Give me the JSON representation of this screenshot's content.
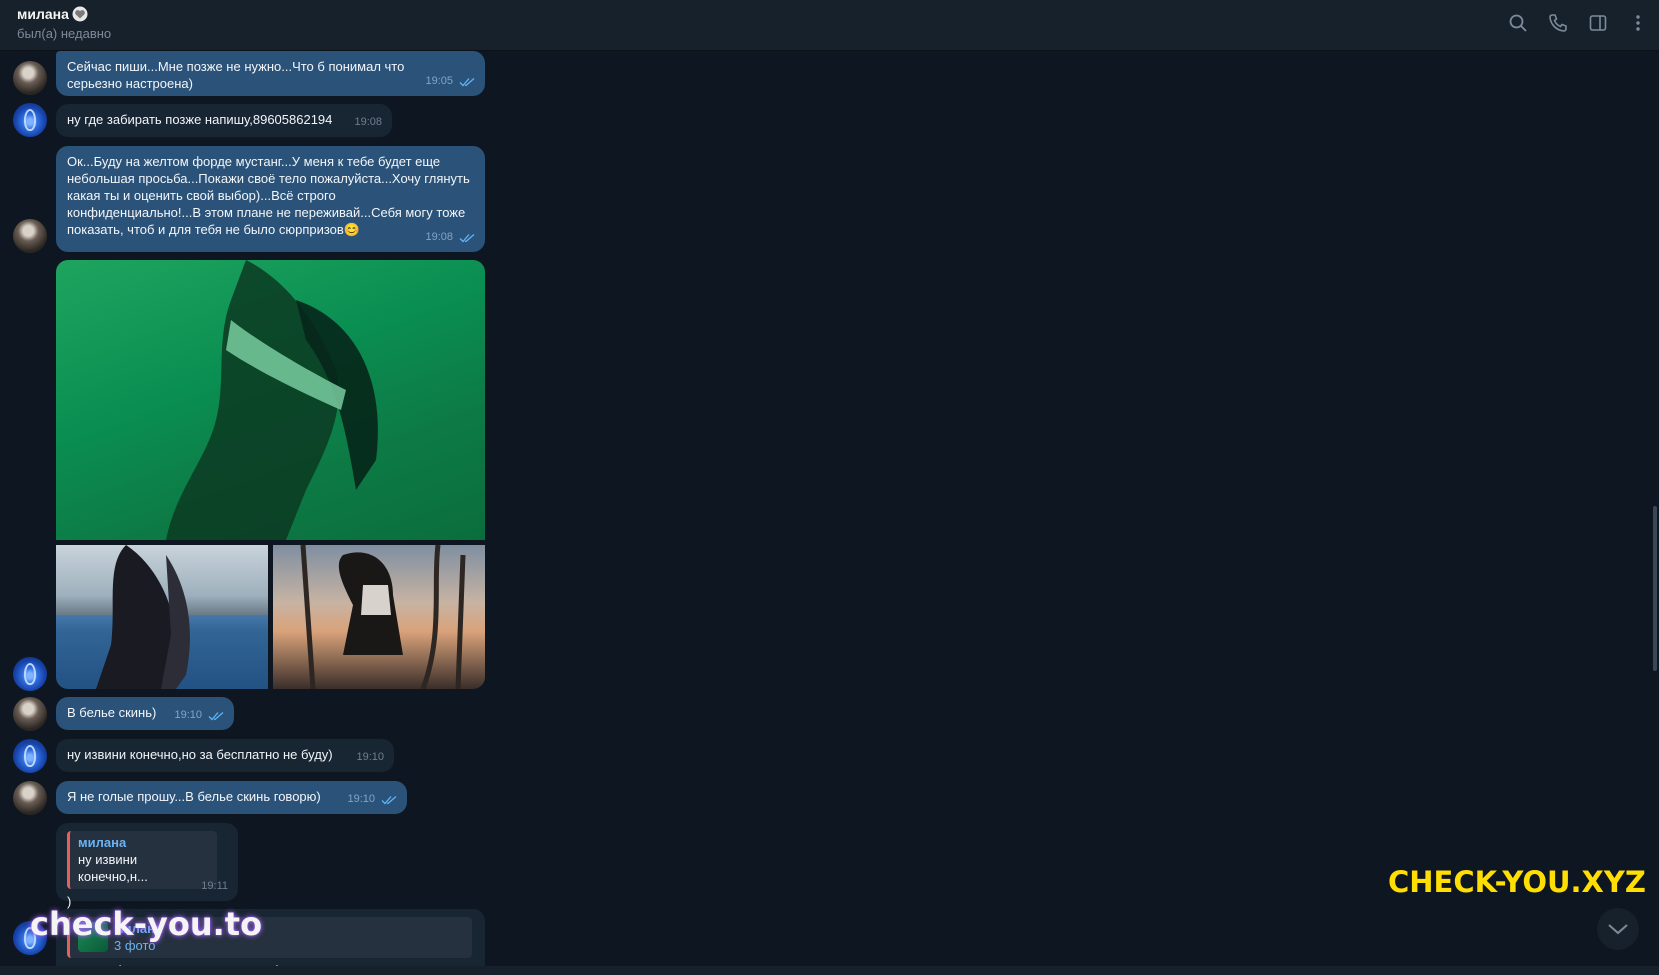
{
  "header": {
    "contact_name": "милана",
    "status": "был(а) недавно"
  },
  "icons": {
    "search": "search-icon",
    "call": "phone-icon",
    "sidebar": "sidebar-toggle-icon",
    "menu": "more-vertical-icon",
    "heart": "heart-icon",
    "ticks": "double-check-icon",
    "scroll_down": "chevron-down-icon"
  },
  "messages": [
    {
      "direction": "out",
      "text": "Сейчас пиши...Мне позже не нужно...Что б понимал что серьезно настроена)",
      "time": "19:05",
      "read": true
    },
    {
      "direction": "in",
      "text": "ну где забирать позже напишу,89605862194",
      "time": "19:08"
    },
    {
      "direction": "out",
      "text": "Ок...Буду на желтом форде мустанг...У меня к тебе будет еще небольшая просьба...Покажи своё тело пожалуйста...Хочу глянуть какая ты и оценить свой выбор)...Всё строго конфиденциально!...В этом плане не переживай...Себя могу тоже показать, чтоб и для тебя не было сюрпризов😊",
      "time": "19:08",
      "read": true
    },
    {
      "direction": "in",
      "type": "album",
      "photos": 3
    },
    {
      "direction": "out",
      "text": "В белье скинь)",
      "time": "19:10",
      "read": true
    },
    {
      "direction": "in",
      "text": "ну извини конечно,но за бесплатно не буду)",
      "time": "19:10"
    },
    {
      "direction": "out",
      "text": "Я не голые прошу...В белье скинь говорю)",
      "time": "19:10",
      "read": true
    },
    {
      "direction": "in",
      "reply_to": {
        "name": "милана",
        "text": "ну извини конечно,н..."
      },
      "text": ")",
      "time": "19:11"
    },
    {
      "direction": "in",
      "reply_to": {
        "name": "милана",
        "text": "3 фото"
      },
      "text": "на этих фотках нормально видна фигура для оценивания норм"
    }
  ],
  "watermarks": {
    "right": "CHECK-YOU.XYZ",
    "left": "check-you.to"
  },
  "colors": {
    "background": "#0e1621",
    "header": "#17212b",
    "outgoing_bubble": "#2b5278",
    "incoming_bubble": "#182533",
    "accent": "#6ab3f3",
    "watermark_yellow": "#ffde03"
  }
}
